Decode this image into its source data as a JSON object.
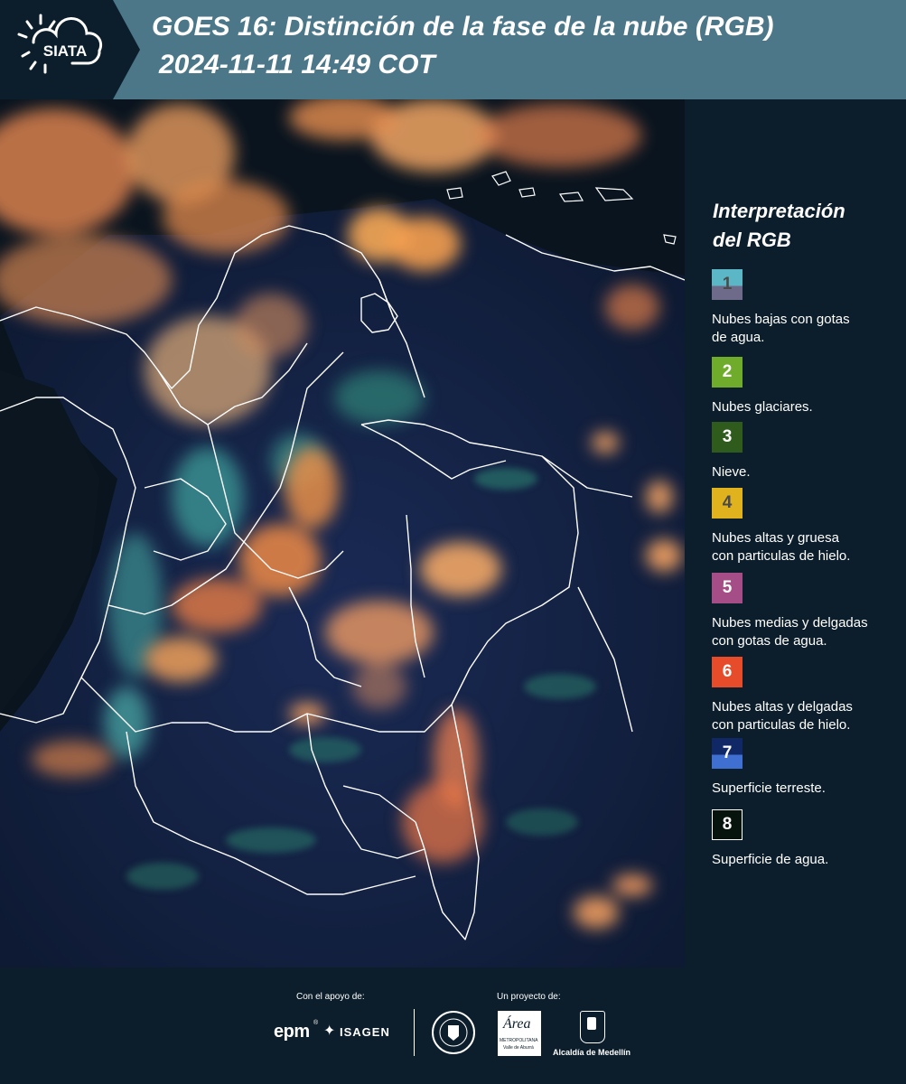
{
  "header": {
    "logo_text": "SIATA",
    "title_line1": "GOES 16: Distinción de la fase de la nube (RGB)",
    "title_line2": "2024-11-11 14:49 COT"
  },
  "legend": {
    "title_line1": "Interpretación",
    "title_line2": "del RGB",
    "items": [
      {
        "number": "1",
        "label_line1": "Nubes bajas con gotas",
        "label_line2": "de agua.",
        "color_top": "#5bb6c6",
        "color_bottom": "#6e6a89",
        "number_color": "#4a4a4a"
      },
      {
        "number": "2",
        "label_line1": "Nubes glaciares.",
        "label_line2": "",
        "color_top": "#6fac2c",
        "color_bottom": "#6fac2c",
        "number_color": "#ffffff"
      },
      {
        "number": "3",
        "label_line1": "Nieve.",
        "label_line2": "",
        "color_top": "#2f5c1c",
        "color_bottom": "#2f5c1c",
        "number_color": "#ffffff"
      },
      {
        "number": "4",
        "label_line1": "Nubes altas y gruesa",
        "label_line2": "con particulas de hielo.",
        "color_top": "#e0b21e",
        "color_bottom": "#e0b21e",
        "number_color": "#4a4a4a"
      },
      {
        "number": "5",
        "label_line1": "Nubes medias y delgadas",
        "label_line2": "con gotas de agua.",
        "color_top": "#a44d86",
        "color_bottom": "#a44d86",
        "number_color": "#ffffff"
      },
      {
        "number": "6",
        "label_line1": "Nubes altas y delgadas",
        "label_line2": "con particulas de hielo.",
        "color_top": "#e64b2a",
        "color_bottom": "#e64b2a",
        "number_color": "#ffffff"
      },
      {
        "number": "7",
        "label_line1": "Superficie terreste.",
        "label_line2": "",
        "color_top": "#102866",
        "color_bottom": "#3f6fd0",
        "number_color": "#ffffff"
      },
      {
        "number": "8",
        "label_line1": "Superficie de agua.",
        "label_line2": "",
        "color_top": "#06140d",
        "color_bottom": "#06140d",
        "number_color": "#ffffff"
      }
    ]
  },
  "footer": {
    "support_label": "Con el apoyo de:",
    "project_label": "Un proyecto de:",
    "sponsor_epm": "epm",
    "sponsor_isagen": "ISAGEN",
    "area_logo_text": "Área",
    "area_logo_line1": "METROPOLITANA",
    "area_logo_line2": "Valle de Aburrá",
    "alcaldia_label": "Alcaldía de Medellín"
  }
}
